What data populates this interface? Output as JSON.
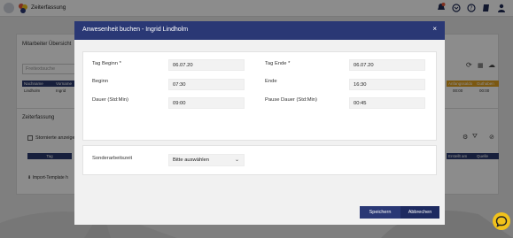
{
  "app": {
    "name": "Zeiterfassung",
    "overview_tab": "Mitarbeiter Übersicht",
    "filter_placeholder": "Freitextsuche",
    "grid_columns": [
      "Nachname",
      "Vorname"
    ],
    "grid_row": [
      "Lindholm",
      "Ingrid"
    ],
    "right_columns": [
      "Anfangssaldo",
      "Guthaben"
    ],
    "right_values": [
      "00:00",
      "00:00"
    ],
    "section_tab": "Zeiterfassung",
    "storno_label": "Stornierte anzeigen",
    "lower_columns": [
      "Tag"
    ],
    "lower_right_columns": [
      "Erstellt am",
      "Quelle"
    ],
    "import_link": "Import-Template h"
  },
  "modal": {
    "title": "Anwesenheit buchen - Ingrid Lindholm",
    "close": "×",
    "fields": {
      "tag_beginn": {
        "label": "Tag Beginn *",
        "value": "06.07.20"
      },
      "tag_ende": {
        "label": "Tag Ende *",
        "value": "06.07.20"
      },
      "beginn": {
        "label": "Beginn",
        "value": "07:30"
      },
      "ende": {
        "label": "Ende",
        "value": "16:30"
      },
      "dauer": {
        "label": "Dauer (Std:Min)",
        "value": "09:00"
      },
      "pause": {
        "label": "Pause Dauer (Std:Min)",
        "value": "00:45"
      }
    },
    "sonder": {
      "label": "Sonderarbeitszeit",
      "selected": "Bitte auswählen"
    },
    "buttons": {
      "save": "Speichern",
      "cancel": "Abbrechen"
    }
  },
  "colors": {
    "header": "#2a3875",
    "accent_orange": "#e0a020",
    "notification": "#e4573a",
    "chat": "#f2c21b"
  }
}
